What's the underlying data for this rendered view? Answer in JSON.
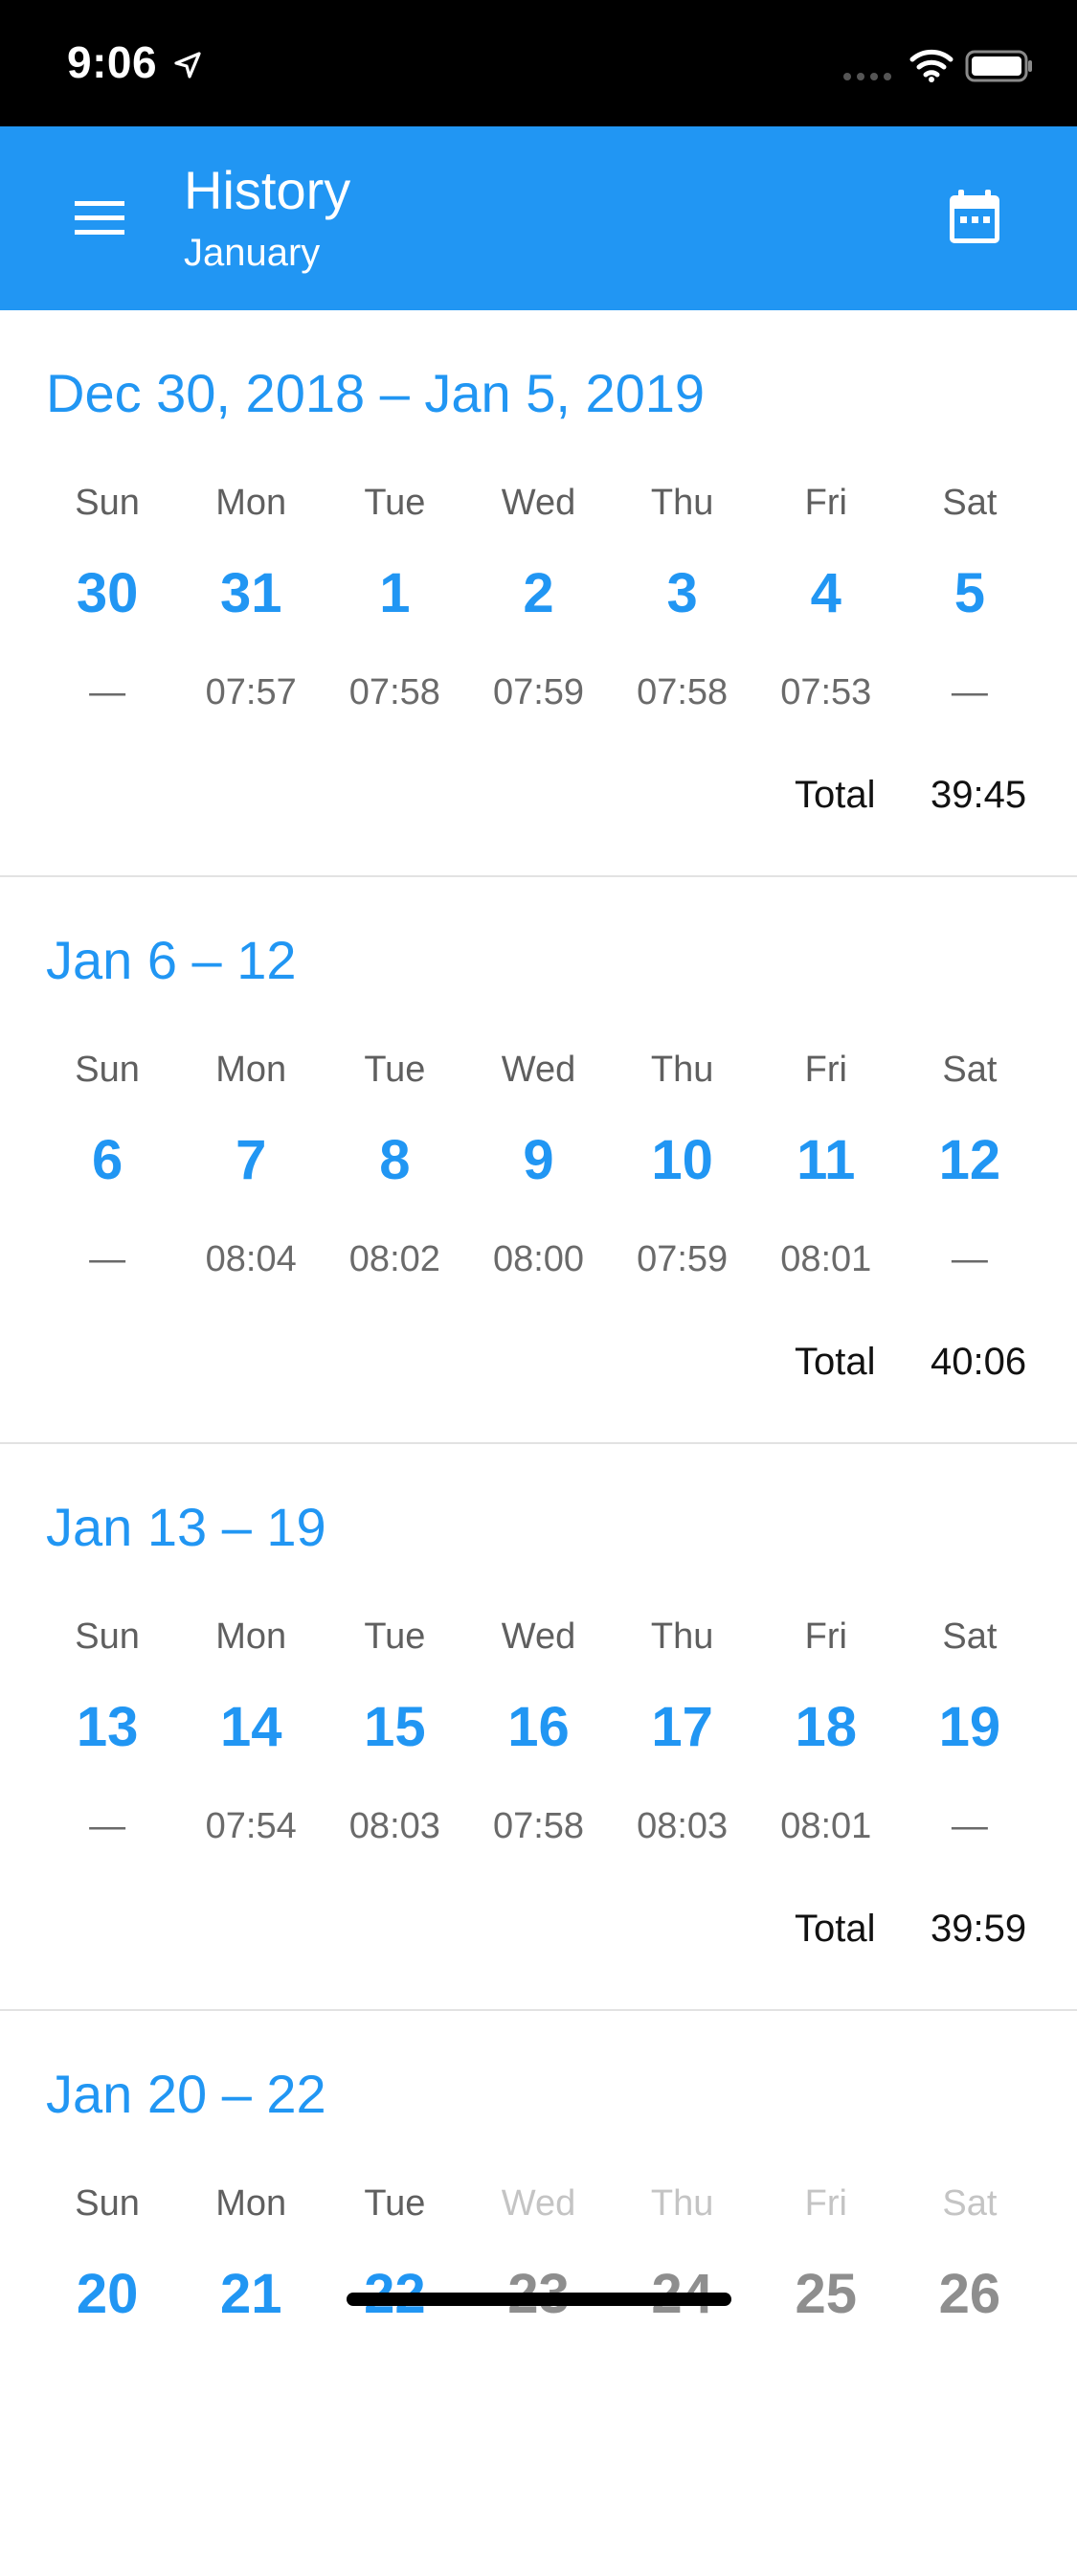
{
  "status_bar": {
    "time": "9:06",
    "icons": [
      "location-arrow-icon",
      "signal-icon",
      "wifi-icon",
      "battery-icon"
    ]
  },
  "app_bar": {
    "title": "History",
    "subtitle": "January",
    "background_color": "#2196f3",
    "icons": [
      "menu-icon",
      "calendar-icon"
    ]
  },
  "weeks": [
    {
      "range": "Dec 30, 2018 – Jan 5, 2019",
      "days": [
        {
          "name": "Sun",
          "num": "30",
          "hours": "—"
        },
        {
          "name": "Mon",
          "num": "31",
          "hours": "07:57"
        },
        {
          "name": "Tue",
          "num": "1",
          "hours": "07:58"
        },
        {
          "name": "Wed",
          "num": "2",
          "hours": "07:59"
        },
        {
          "name": "Thu",
          "num": "3",
          "hours": "07:58"
        },
        {
          "name": "Fri",
          "num": "4",
          "hours": "07:53"
        },
        {
          "name": "Sat",
          "num": "5",
          "hours": "—"
        }
      ],
      "total_label": "Total",
      "total_value": "39:45"
    },
    {
      "range": "Jan 6 – 12",
      "days": [
        {
          "name": "Sun",
          "num": "6",
          "hours": "—"
        },
        {
          "name": "Mon",
          "num": "7",
          "hours": "08:04"
        },
        {
          "name": "Tue",
          "num": "8",
          "hours": "08:02"
        },
        {
          "name": "Wed",
          "num": "9",
          "hours": "08:00"
        },
        {
          "name": "Thu",
          "num": "10",
          "hours": "07:59"
        },
        {
          "name": "Fri",
          "num": "11",
          "hours": "08:01"
        },
        {
          "name": "Sat",
          "num": "12",
          "hours": "—"
        }
      ],
      "total_label": "Total",
      "total_value": "40:06"
    },
    {
      "range": "Jan 13 – 19",
      "days": [
        {
          "name": "Sun",
          "num": "13",
          "hours": "—"
        },
        {
          "name": "Mon",
          "num": "14",
          "hours": "07:54"
        },
        {
          "name": "Tue",
          "num": "15",
          "hours": "08:03"
        },
        {
          "name": "Wed",
          "num": "16",
          "hours": "07:58"
        },
        {
          "name": "Thu",
          "num": "17",
          "hours": "08:03"
        },
        {
          "name": "Fri",
          "num": "18",
          "hours": "08:01"
        },
        {
          "name": "Sat",
          "num": "19",
          "hours": "—"
        }
      ],
      "total_label": "Total",
      "total_value": "39:59"
    },
    {
      "range": "Jan 20 – 22",
      "days": [
        {
          "name": "Sun",
          "num": "20"
        },
        {
          "name": "Mon",
          "num": "21"
        },
        {
          "name": "Tue",
          "num": "22"
        },
        {
          "name": "Wed",
          "num": "23"
        },
        {
          "name": "Thu",
          "num": "24"
        },
        {
          "name": "Fri",
          "num": "25"
        },
        {
          "name": "Sat",
          "num": "26"
        }
      ]
    }
  ]
}
